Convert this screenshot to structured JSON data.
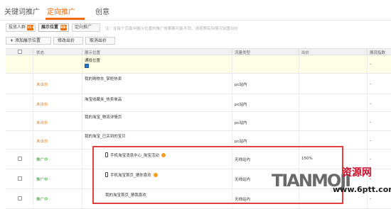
{
  "top_tabs": [
    "关键词推广",
    "定向推广",
    "创意"
  ],
  "sub_tabs": [
    {
      "label": "投放人群",
      "badge": "99+"
    },
    {
      "label": "展示位置",
      "badge": "99+"
    },
    {
      "label": "定向推广",
      "badge": ""
    }
  ],
  "hint": "注：在每个页面中展示位置的推广效果都可能不同，请按照实际情况设置出价",
  "actions": {
    "add": "添加展示位置",
    "modify": "修改出价",
    "cancel": "取消出价"
  },
  "columns": [
    "状态",
    "展示位置",
    "流量类型",
    "出价",
    "展现指数"
  ],
  "rows": [
    {
      "checkbox": false,
      "status": "",
      "status_type": "",
      "position": "通投位置",
      "icon": "bluebox",
      "flow": "",
      "bid": "",
      "dash": "-"
    },
    {
      "checkbox": false,
      "status": "未出价",
      "status_type": "pending",
      "position": "我的购物车_掌柜热卖",
      "icon": "",
      "flow": "pc站内",
      "bid": "",
      "dash": "-"
    },
    {
      "checkbox": false,
      "status": "未出价",
      "status_type": "pending",
      "position": "淘宝收藏夹_热卖单品",
      "icon": "",
      "flow": "pc站内",
      "bid": "",
      "dash": "-"
    },
    {
      "checkbox": false,
      "status": "未出价",
      "status_type": "pending",
      "position": "我的淘宝_物流详情页",
      "icon": "",
      "flow": "pc站内",
      "bid": "",
      "dash": "-"
    },
    {
      "checkbox": false,
      "status": "未出价",
      "status_type": "pending",
      "position": "我的淘宝_已买到的宝贝",
      "icon": "",
      "flow": "pc站内",
      "bid": "",
      "dash": "-"
    },
    {
      "checkbox": true,
      "status": "推广中",
      "status_type": "active",
      "position": "手机淘宝消息中心_淘宝活动",
      "icon": "phone",
      "flow": "无线站内",
      "bid": "150%",
      "dash": "-"
    },
    {
      "checkbox": true,
      "status": "推广中",
      "status_type": "active",
      "position": "手机淘宝首页_猜你喜欢",
      "icon": "phone",
      "flow": "无线站内",
      "bid": "",
      "dash": "-"
    },
    {
      "checkbox": true,
      "status": "推广中",
      "status_type": "active",
      "position": "我的淘宝首页_猜我喜欢",
      "icon": "",
      "flow": "无线站内",
      "bid": "",
      "dash": "-"
    }
  ],
  "watermark": {
    "big": "TIANMOJI",
    "cn": "资源网",
    "url": "www.6ptt.com"
  },
  "colors": {
    "accent": "#f26c0d",
    "pending": "#f07a10",
    "active": "#2c9a2c",
    "highlight": "#e04040"
  }
}
